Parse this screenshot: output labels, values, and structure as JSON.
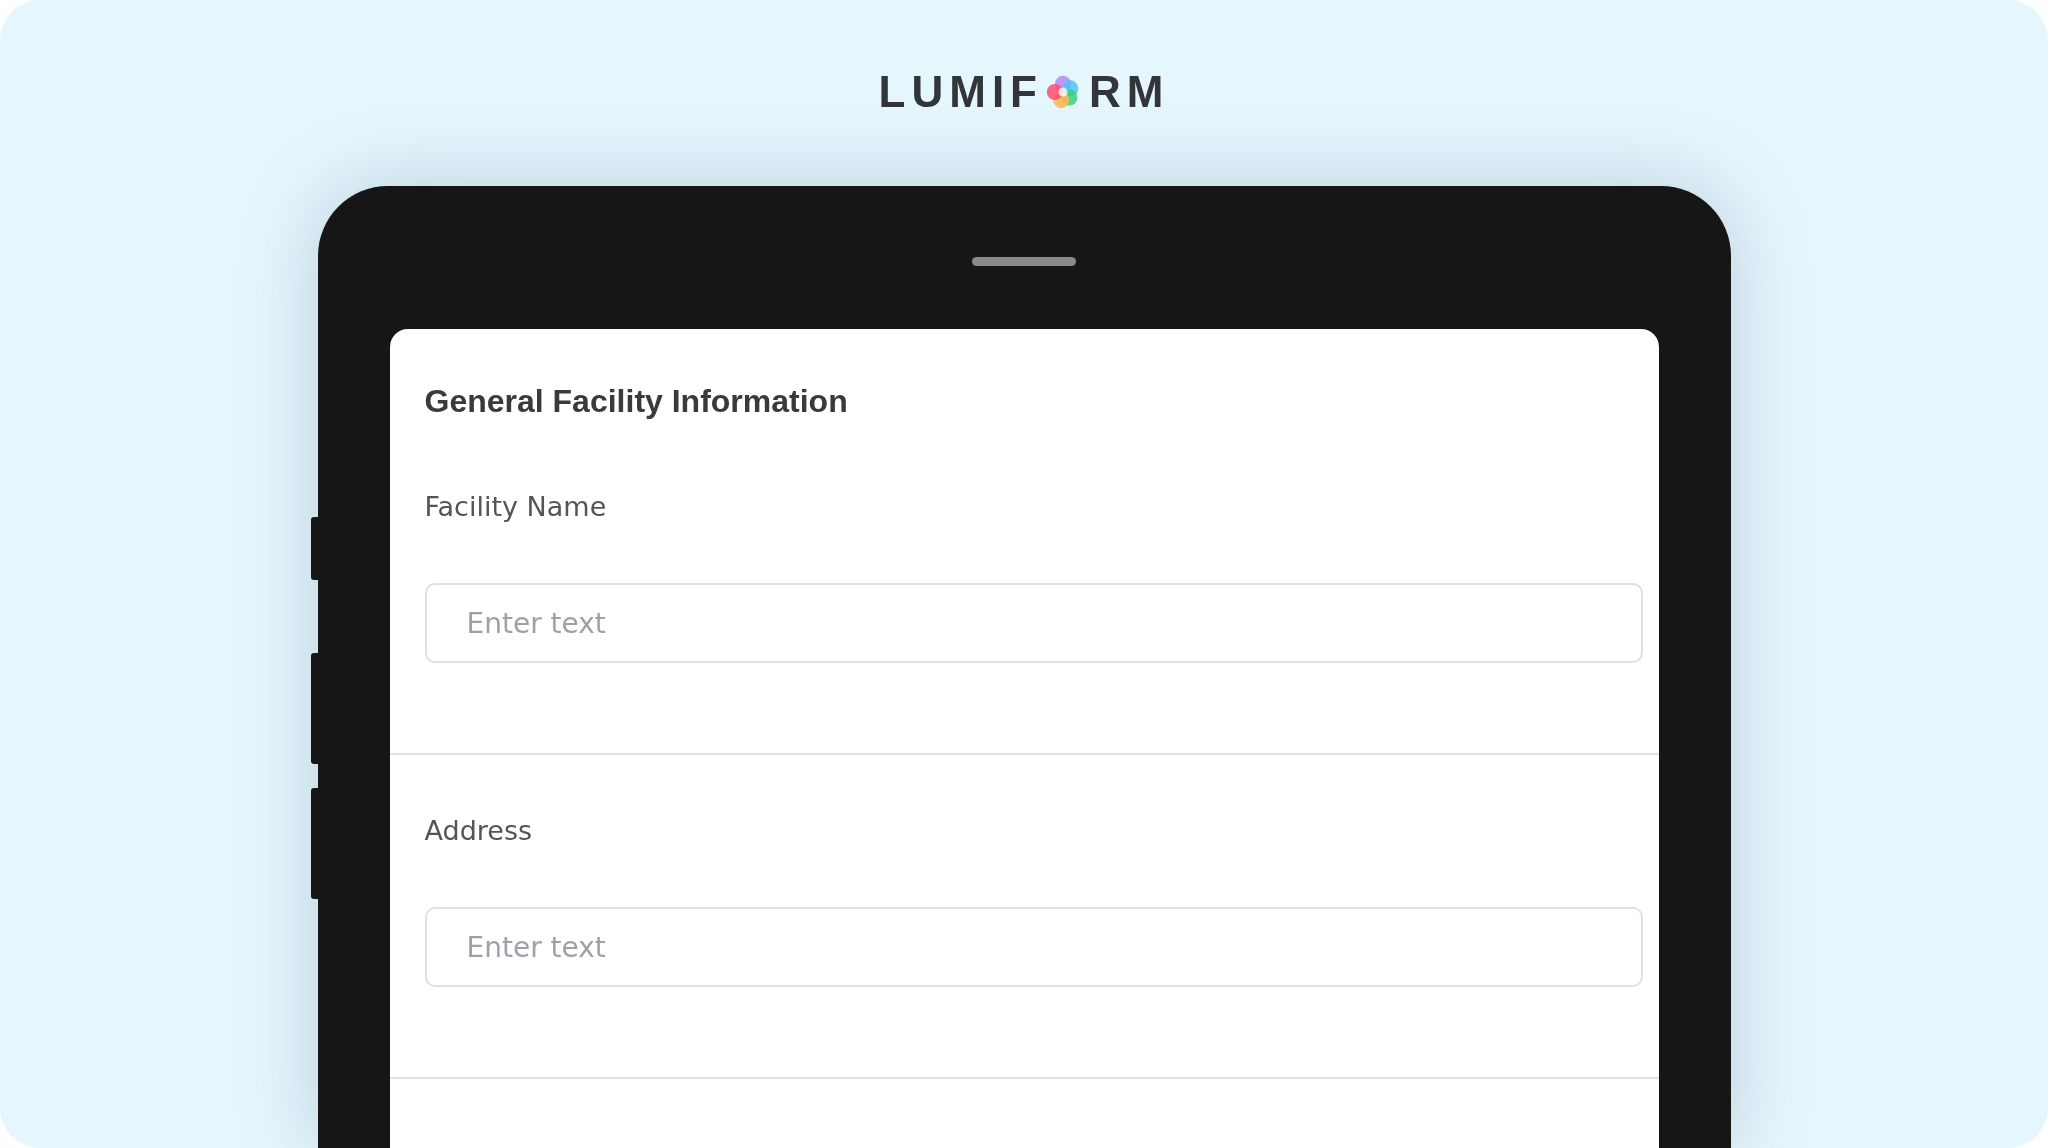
{
  "logo": {
    "before_mark": "LUMIF",
    "after_mark": "RM"
  },
  "form": {
    "title": "General Facility Information",
    "questions": [
      {
        "label": "Facility Name",
        "placeholder": "Enter text"
      },
      {
        "label": "Address",
        "placeholder": "Enter text"
      }
    ]
  }
}
